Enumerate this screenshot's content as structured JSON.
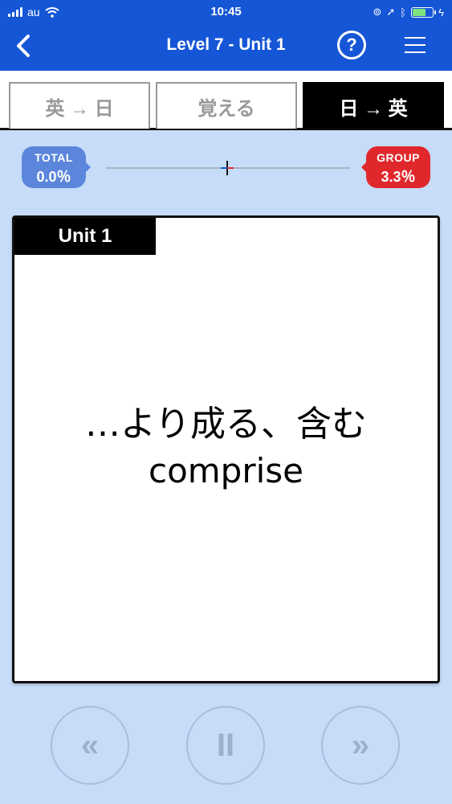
{
  "status": {
    "carrier": "au",
    "time": "10:45",
    "battery_level": 0.6
  },
  "nav": {
    "title": "Level 7 - Unit 1",
    "help_label": "?"
  },
  "tabs": [
    {
      "label": "英 → 日",
      "active": false
    },
    {
      "label": "覚える",
      "active": false
    },
    {
      "label": "日 → 英",
      "active": true
    }
  ],
  "progress": {
    "total_label": "TOTAL",
    "total_value": "0.0％",
    "group_label": "GROUP",
    "group_value": "3.3％"
  },
  "card": {
    "unit_label": "Unit 1",
    "japanese": "…より成る、含む",
    "english": "comprise"
  },
  "controls": {
    "prev": "«",
    "pause": "II",
    "next": "»"
  },
  "colors": {
    "nav_blue": "#1556d6",
    "background": "#c6dcf8",
    "total_pill": "#5b86dc",
    "group_pill": "#e0282c"
  }
}
